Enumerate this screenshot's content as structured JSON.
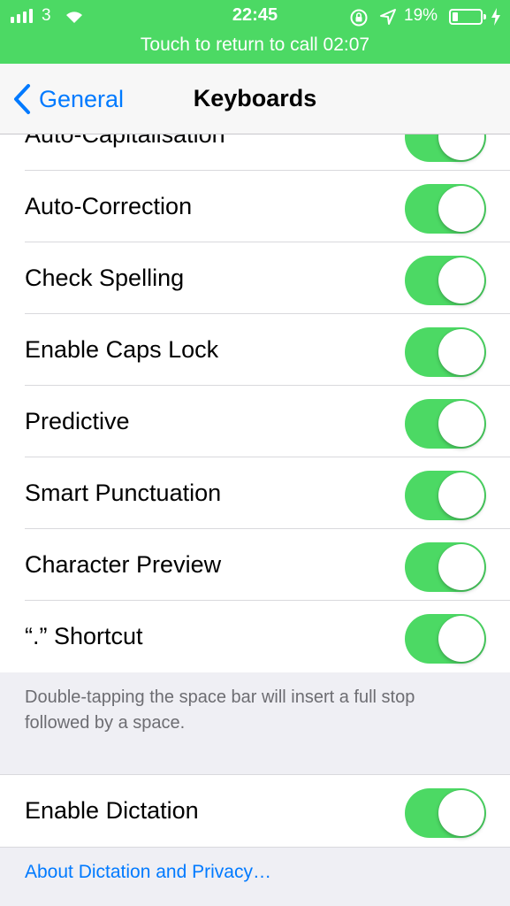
{
  "status_bar": {
    "carrier": "3",
    "time": "22:45",
    "battery_percent": "19%",
    "battery_level": 0.19,
    "call_banner": "Touch to return to call 02:07",
    "icons": [
      "signal-icon",
      "wifi-icon",
      "orientation-lock-icon",
      "location-icon",
      "battery-icon",
      "charging-bolt-icon"
    ]
  },
  "nav": {
    "back_label": "General",
    "title": "Keyboards"
  },
  "settings": {
    "rows": [
      {
        "label": "Auto-Capitalisation",
        "on": true
      },
      {
        "label": "Auto-Correction",
        "on": true
      },
      {
        "label": "Check Spelling",
        "on": true
      },
      {
        "label": "Enable Caps Lock",
        "on": true
      },
      {
        "label": "Predictive",
        "on": true
      },
      {
        "label": "Smart Punctuation",
        "on": true
      },
      {
        "label": "Character Preview",
        "on": true
      },
      {
        "label": "“.” Shortcut",
        "on": true
      }
    ],
    "shortcut_footer": "Double-tapping the space bar will insert a full stop followed by a space.",
    "dictation": {
      "label": "Enable Dictation",
      "on": true
    },
    "dictation_link": "About Dictation and Privacy…"
  },
  "colors": {
    "accent": "#007aff",
    "toggle_on": "#4cd964",
    "status_bar": "#4cd964",
    "background": "#efeff4"
  }
}
